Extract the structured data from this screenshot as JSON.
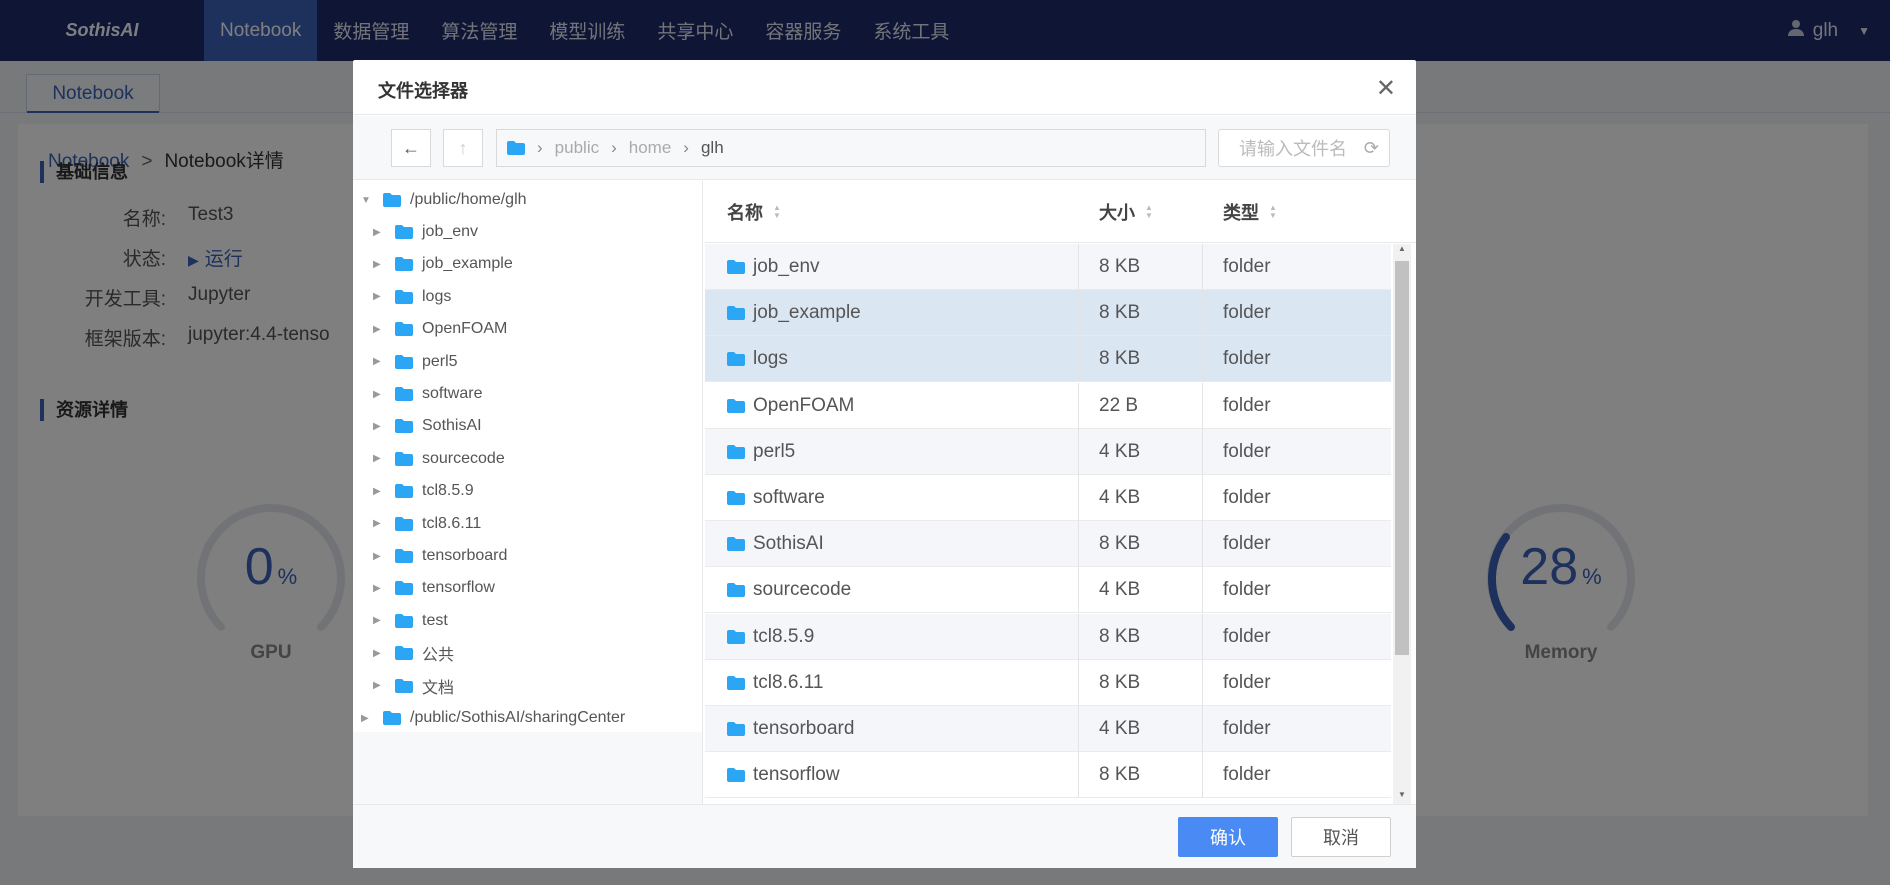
{
  "app": {
    "logo": "SothisAI"
  },
  "nav": {
    "items": [
      "Notebook",
      "数据管理",
      "算法管理",
      "模型训练",
      "共享中心",
      "容器服务",
      "系统工具"
    ],
    "user": "glh"
  },
  "subtabs": [
    "Notebook"
  ],
  "breadcrumb": [
    "Notebook",
    "Notebook详情"
  ],
  "basic": {
    "title": "基础信息",
    "fields": [
      {
        "k": "名称:",
        "v": "Test3"
      },
      {
        "k": "状态:",
        "v": "运行"
      },
      {
        "k": "开发工具:",
        "v": "Jupyter"
      },
      {
        "k": "框架版本:",
        "v": "jupyter:4.4-tenso"
      }
    ]
  },
  "resource": {
    "title": "资源详情",
    "gpu": {
      "value": "0",
      "unit": "%",
      "label": "GPU",
      "level": 0
    },
    "memory": {
      "value": "28",
      "unit": "%",
      "label": "Memory",
      "level": 0.28
    }
  },
  "dialog": {
    "title": "文件选择器",
    "path": [
      "public",
      "home",
      "glh"
    ],
    "search_placeholder": "请输入文件名",
    "tree": {
      "root": "/public/home/glh",
      "children": [
        "job_env",
        "job_example",
        "logs",
        "OpenFOAM",
        "perl5",
        "software",
        "SothisAI",
        "sourcecode",
        "tcl8.5.9",
        "tcl8.6.11",
        "tensorboard",
        "tensorflow",
        "test",
        "公共",
        "文档"
      ],
      "second_root": "/public/SothisAI/sharingCenter"
    },
    "columns": [
      "名称",
      "大小",
      "类型"
    ],
    "rows": [
      {
        "name": "job_env",
        "size": "8 KB",
        "type": "folder"
      },
      {
        "name": "job_example",
        "size": "8 KB",
        "type": "folder"
      },
      {
        "name": "logs",
        "size": "8 KB",
        "type": "folder"
      },
      {
        "name": "OpenFOAM",
        "size": "22 B",
        "type": "folder"
      },
      {
        "name": "perl5",
        "size": "4 KB",
        "type": "folder"
      },
      {
        "name": "software",
        "size": "4 KB",
        "type": "folder"
      },
      {
        "name": "SothisAI",
        "size": "8 KB",
        "type": "folder"
      },
      {
        "name": "sourcecode",
        "size": "4 KB",
        "type": "folder"
      },
      {
        "name": "tcl8.5.9",
        "size": "8 KB",
        "type": "folder"
      },
      {
        "name": "tcl8.6.11",
        "size": "8 KB",
        "type": "folder"
      },
      {
        "name": "tensorboard",
        "size": "4 KB",
        "type": "folder"
      },
      {
        "name": "tensorflow",
        "size": "8 KB",
        "type": "folder"
      }
    ],
    "selected_rows": [
      "job_example",
      "logs"
    ],
    "confirm": "确认",
    "cancel": "取消"
  },
  "colors": {
    "nav_bg": "#1c2a6b",
    "accent": "#3b63b8",
    "folder": "#2aa6f5",
    "primary_button": "#4a8af4"
  }
}
